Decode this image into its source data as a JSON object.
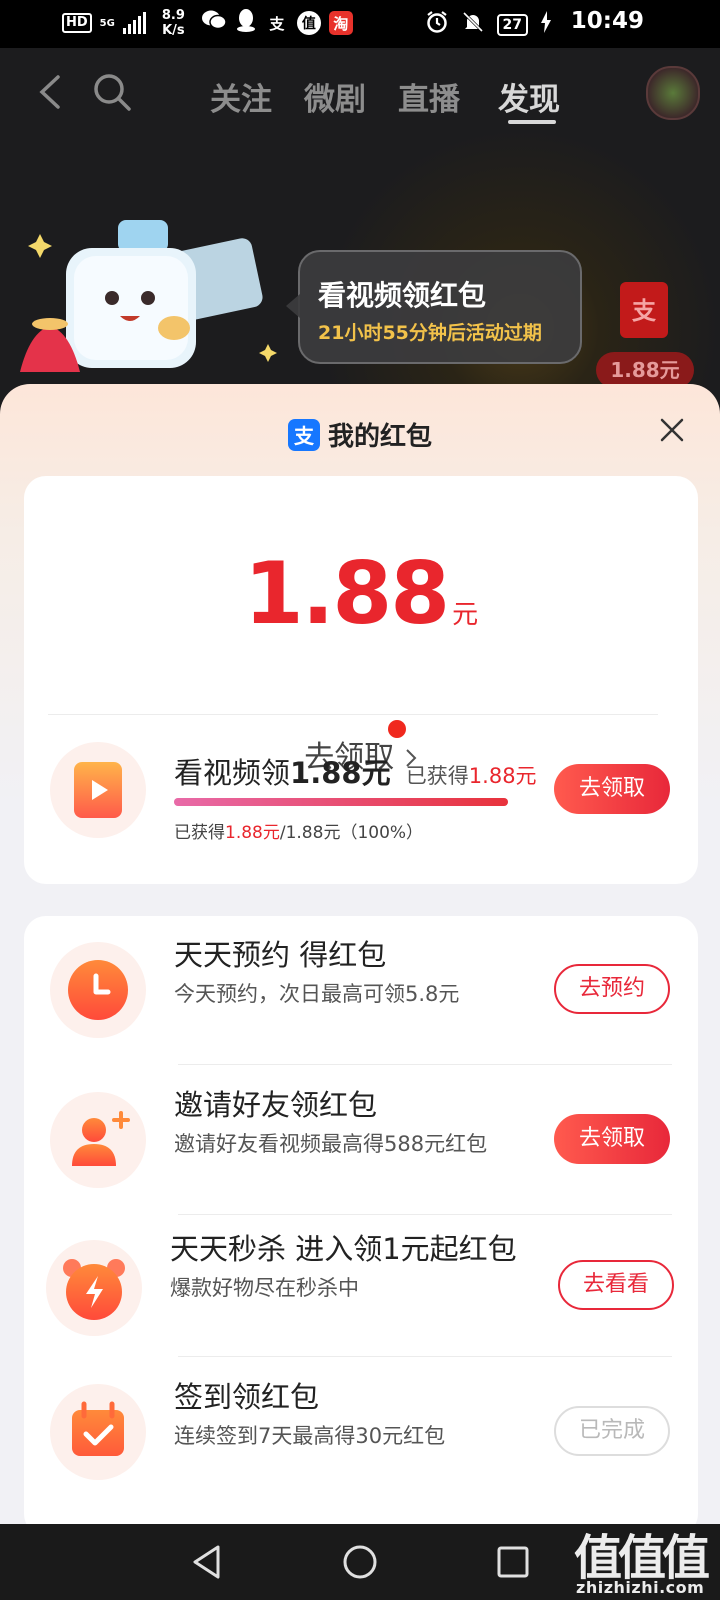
{
  "status_bar": {
    "hd": "HD",
    "net": "5G",
    "speed_value": "8.9",
    "speed_unit": "K/s",
    "alipay_glyph": "支",
    "value_glyph": "值",
    "taobao_glyph": "淘",
    "battery": "27",
    "time": "10:49"
  },
  "top_nav": {
    "tabs": [
      {
        "label": "关注",
        "active": false
      },
      {
        "label": "微剧",
        "active": false
      },
      {
        "label": "直播",
        "active": false
      },
      {
        "label": "发现",
        "active": true
      }
    ]
  },
  "banner": {
    "title": "看视频领红包",
    "subtitle": "21小时55分钟后活动过期",
    "side_glyph": "支",
    "side_amount": "1.88元"
  },
  "sheet": {
    "title": "我的红包",
    "alipay_glyph": "支",
    "amount": "1.88",
    "amount_unit": "元",
    "claim_label": "去领取"
  },
  "video_task": {
    "title_prefix": "看视频领",
    "title_amount": "1.88元",
    "earned_label": "已获得",
    "earned_amount": "1.88元",
    "progress_percent": 100,
    "progress_prefix": "已获得",
    "progress_amount": "1.88元",
    "progress_suffix": "/1.88元（100%）",
    "button": "去领取"
  },
  "tasks": [
    {
      "title": "天天预约 得红包",
      "subtitle": "今天预约，次日最高可领5.8元",
      "button": "去预约",
      "icon": "clock-icon"
    },
    {
      "title": "邀请好友领红包",
      "subtitle": "邀请好友看视频最高得588元红包",
      "button": "去领取",
      "icon": "add-friend-icon"
    },
    {
      "title": "天天秒杀 进入领1元起红包",
      "subtitle": "爆款好物尽在秒杀中",
      "button": "去看看",
      "icon": "alarm-lightning-icon"
    },
    {
      "title": "签到领红包",
      "subtitle": "连续签到7天最高得30元红包",
      "button": "已完成",
      "icon": "calendar-check-icon"
    }
  ],
  "watermark": {
    "big": "值值值",
    "small": "zhizhizhi.com"
  },
  "colors": {
    "accent_red": "#e9262d",
    "alipay_blue": "#1677ff",
    "bubble_gold": "#f2c24a"
  }
}
